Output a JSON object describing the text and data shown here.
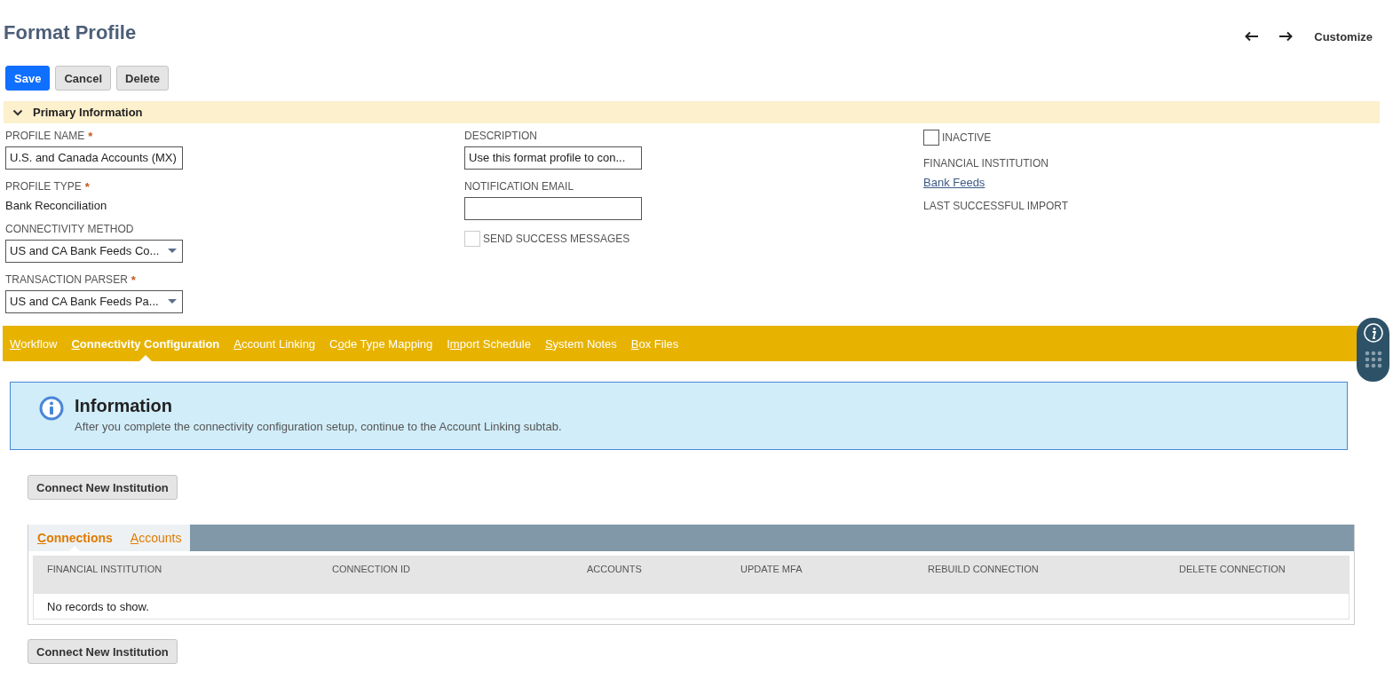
{
  "page": {
    "title": "Format Profile",
    "nav": [
      {
        "kind": "back"
      },
      {
        "kind": "forward"
      }
    ],
    "customize": "Customize"
  },
  "actions": [
    {
      "label": "Save",
      "kind": "primary"
    },
    {
      "label": "Cancel",
      "kind": "secondary"
    },
    {
      "label": "Delete",
      "kind": "secondary"
    }
  ],
  "section": {
    "title": "Primary Information",
    "expanded": true
  },
  "columns": [
    [
      {
        "kind": "input",
        "label": "PROFILE NAME",
        "marker": "*",
        "value": "U.S. and Canada Accounts (MX)"
      },
      {
        "kind": "text",
        "label": "PROFILE TYPE",
        "marker": "*",
        "value": "Bank Reconciliation"
      },
      {
        "kind": "select",
        "label": "CONNECTIVITY METHOD",
        "value": "US and CA Bank Feeds Co..."
      },
      {
        "kind": "select",
        "label": "TRANSACTION PARSER",
        "marker": "*",
        "value": "US and CA Bank Feeds Pa..."
      }
    ],
    [
      {
        "kind": "input",
        "label": "DESCRIPTION",
        "value": "Use this format profile to con..."
      },
      {
        "kind": "input",
        "label": "NOTIFICATION EMAIL"
      },
      {
        "kind": "checkbox",
        "label": "SEND SUCCESS MESSAGES",
        "checked": false,
        "disabled": true
      }
    ],
    [
      {
        "kind": "checkbox",
        "label": "INACTIVE",
        "checked": false,
        "disabled": false
      },
      {
        "kind": "link",
        "label": "FINANCIAL INSTITUTION",
        "value": "Bank Feeds"
      },
      {
        "kind": "text",
        "label": "LAST SUCCESSFUL IMPORT"
      }
    ]
  ],
  "tabs": [
    {
      "key": "W",
      "after": "orkflow",
      "selected": false
    },
    {
      "key": "C",
      "after": "onnectivity Configuration",
      "selected": true
    },
    {
      "key": "A",
      "after": "ccount Linking",
      "selected": false
    },
    {
      "before": "C",
      "key": "o",
      "after": "de Type Mapping",
      "selected": false
    },
    {
      "before": "I",
      "key": "m",
      "after": "port Schedule",
      "selected": false
    },
    {
      "key": "S",
      "after": "ystem Notes",
      "selected": false
    },
    {
      "key": "B",
      "after": "ox Files",
      "selected": false
    }
  ],
  "info": {
    "title": "Information",
    "message": "After you complete the connectivity configuration setup, continue to the Account Linking subtab."
  },
  "connect_button": "Connect New Institution",
  "subtabs": [
    {
      "key": "C",
      "after": "onnections",
      "selected": true
    },
    {
      "key": "A",
      "after": "ccounts",
      "selected": false
    }
  ],
  "table": {
    "columns": [
      "FINANCIAL INSTITUTION",
      "CONNECTION ID",
      "ACCOUNTS",
      "UPDATE MFA",
      "REBUILD CONNECTION",
      "DELETE CONNECTION"
    ],
    "empty": "No records to show."
  },
  "connect_button_bottom": "Connect New Institution"
}
